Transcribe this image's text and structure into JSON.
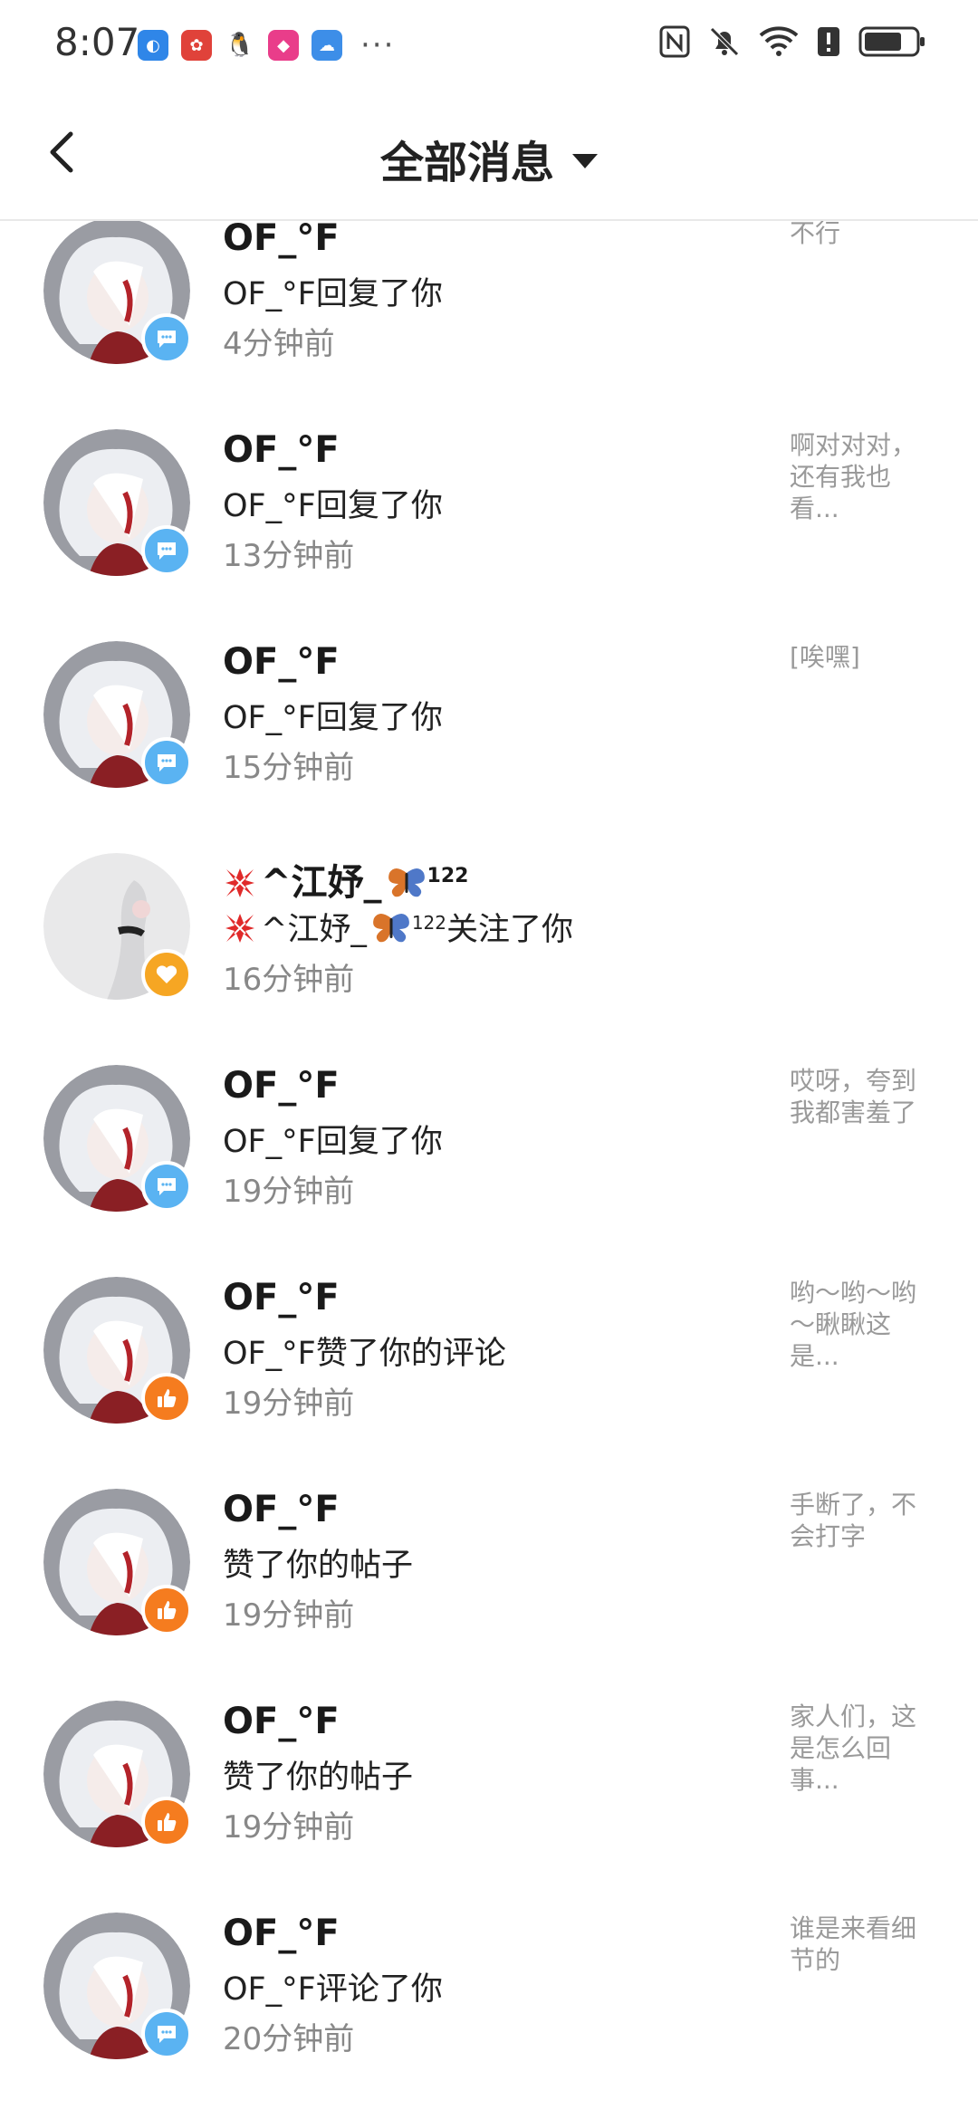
{
  "status_bar": {
    "time": "8:07",
    "more": "···",
    "icons": [
      "notification-app-icon",
      "huawei-app-icon",
      "qq-icon",
      "shopping-app-icon",
      "weather-app-icon",
      "nfc-icon",
      "mute-icon",
      "wifi-icon",
      "alert-icon",
      "battery-icon"
    ]
  },
  "header": {
    "title": "全部消息"
  },
  "messages": [
    {
      "name": "OF_°F",
      "action": "OF_°F回复了你",
      "time": "4分钟前",
      "snippet": "不行",
      "type": "reply"
    },
    {
      "name": "OF_°F",
      "action": "OF_°F回复了你",
      "time": "13分钟前",
      "snippet": "啊对对对，还有我也看...",
      "type": "reply"
    },
    {
      "name": "OF_°F",
      "action": "OF_°F回复了你",
      "time": "15分钟前",
      "snippet": "[唉嘿]",
      "type": "reply"
    },
    {
      "name": "^江妤_",
      "name_sup": "122",
      "action": "^江妤_",
      "action_sup": "122",
      "action_suffix": "关注了你",
      "time": "16分钟前",
      "snippet": "",
      "type": "follow"
    },
    {
      "name": "OF_°F",
      "action": "OF_°F回复了你",
      "time": "19分钟前",
      "snippet": "哎呀，夸到我都害羞了",
      "type": "reply"
    },
    {
      "name": "OF_°F",
      "action": "OF_°F赞了你的评论",
      "time": "19分钟前",
      "snippet": "哟～哟～哟～瞅瞅这是...",
      "type": "like"
    },
    {
      "name": "OF_°F",
      "action": "赞了你的帖子",
      "time": "19分钟前",
      "snippet": "手断了，不会打字",
      "type": "like"
    },
    {
      "name": "OF_°F",
      "action": "赞了你的帖子",
      "time": "19分钟前",
      "snippet": "家人们，这是怎么回事...",
      "type": "like"
    },
    {
      "name": "OF_°F",
      "action": "OF_°F评论了你",
      "time": "20分钟前",
      "snippet": "谁是来看细节的",
      "type": "reply"
    }
  ],
  "colors": {
    "reply_badge": "#5ab3f2",
    "like_badge": "#f57c1f",
    "follow_badge": "#f6a623",
    "secondary_text": "#888888"
  }
}
